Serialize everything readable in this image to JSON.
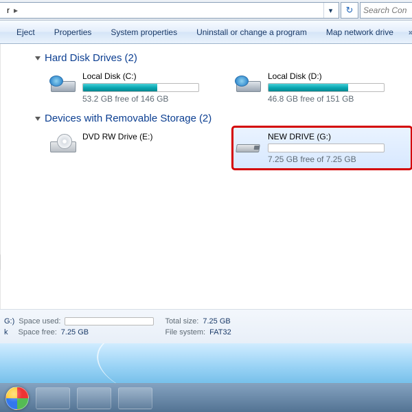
{
  "address": {
    "crumb_suffix": "r",
    "dropdown_glyph": "▾",
    "refresh_glyph": "↻"
  },
  "search": {
    "placeholder": "Search Con"
  },
  "toolbar": {
    "eject": "Eject",
    "properties": "Properties",
    "system_properties": "System properties",
    "uninstall": "Uninstall or change a program",
    "map_drive": "Map network drive",
    "overflow_glyph": "»"
  },
  "groups": {
    "hdd": {
      "title": "Hard Disk Drives",
      "count": "(2)"
    },
    "removable": {
      "title": "Devices with Removable Storage",
      "count": "(2)"
    }
  },
  "drives": {
    "c": {
      "label": "Local Disk (C:)",
      "status": "53.2 GB free of 146 GB",
      "fill_pct": 64
    },
    "d": {
      "label": "Local Disk (D:)",
      "status": "46.8 GB free of 151 GB",
      "fill_pct": 69
    },
    "dvd": {
      "label": "DVD RW Drive (E:)"
    },
    "g": {
      "label": "NEW DRIVE (G:)",
      "status": "7.25 GB free of 7.25 GB",
      "fill_pct": 0
    }
  },
  "details": {
    "name_suffix": "G:)",
    "type_suffix": "k",
    "space_used_label": "Space used:",
    "space_free_label": "Space free:",
    "space_free_value": "7.25 GB",
    "total_size_label": "Total size:",
    "total_size_value": "7.25 GB",
    "file_system_label": "File system:",
    "file_system_value": "FAT32"
  }
}
